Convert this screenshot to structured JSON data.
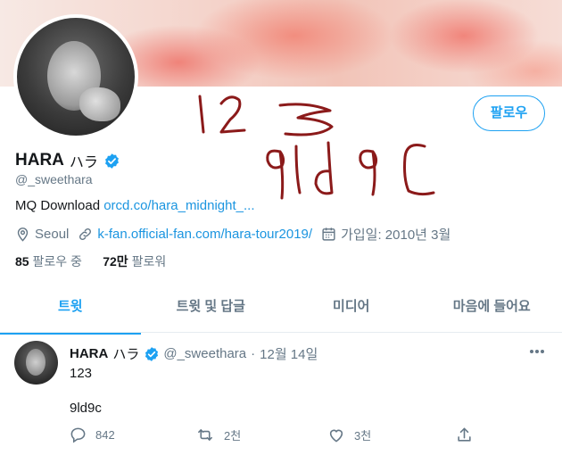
{
  "profile": {
    "name": "HARA",
    "name_suffix": "ハラ",
    "handle": "@_sweethara",
    "follow_button": "팔로우",
    "bio_text": "MQ Download",
    "bio_link": "orcd.co/hara_midnight_...",
    "location": "Seoul",
    "website": "k-fan.official-fan.com/hara-tour2019/",
    "joined": "가입일: 2010년 3월",
    "following_count": "85",
    "following_label": "팔로우 중",
    "followers_count": "72만",
    "followers_label": "팔로워"
  },
  "tabs": [
    "트윗",
    "트윗 및 답글",
    "미디어",
    "마음에 들어요"
  ],
  "tweet": {
    "name": "HARA",
    "name_suffix": "ハラ",
    "handle": "@_sweethara",
    "separator": "·",
    "date": "12월 14일",
    "line1": "123",
    "line2": "9ld9c",
    "replies": "842",
    "retweets": "2천",
    "likes": "3천"
  },
  "icons": {
    "verified": "verified-badge-icon",
    "location": "location-pin-icon",
    "link": "link-icon",
    "calendar": "calendar-icon",
    "more": "more-options-icon",
    "reply": "reply-icon",
    "retweet": "retweet-icon",
    "like": "heart-icon",
    "share": "share-icon"
  },
  "colors": {
    "accent": "#1da1f2",
    "link": "#1b95e0",
    "secondary_text": "#657786",
    "scribble": "#8b1a1a"
  }
}
